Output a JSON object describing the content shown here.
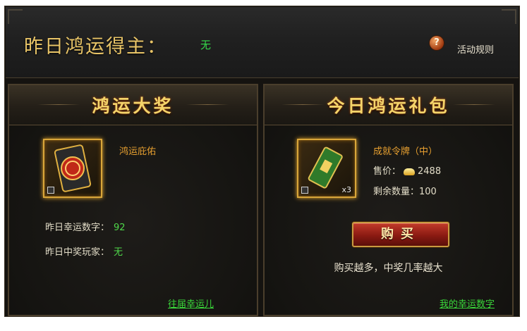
{
  "header": {
    "title": "昨日鸿运得主：",
    "winner": "无",
    "help_icon_glyph": "?",
    "rules_label": "活动规则"
  },
  "left_panel": {
    "title": "鸿运大奖",
    "item_name": "鸿运庇佑",
    "lucky_number_label": "昨日幸运数字：",
    "lucky_number_value": "92",
    "winner_label": "昨日中奖玩家：",
    "winner_value": "无",
    "history_link": "往届幸运儿"
  },
  "right_panel": {
    "title": "今日鸿运礼包",
    "item_name": "成就令牌（中）",
    "item_quantity": "x3",
    "price_label": "售价：",
    "price_value": "2488",
    "remaining_label": "剩余数量：",
    "remaining_value": "100",
    "buy_label": "购买",
    "note": "购买越多，中奖几率越大",
    "my_numbers_link": "我的幸运数字"
  },
  "colors": {
    "gold_title": "#f4d46a",
    "green_value": "#4fd84a",
    "item_orange": "#e8a030"
  }
}
